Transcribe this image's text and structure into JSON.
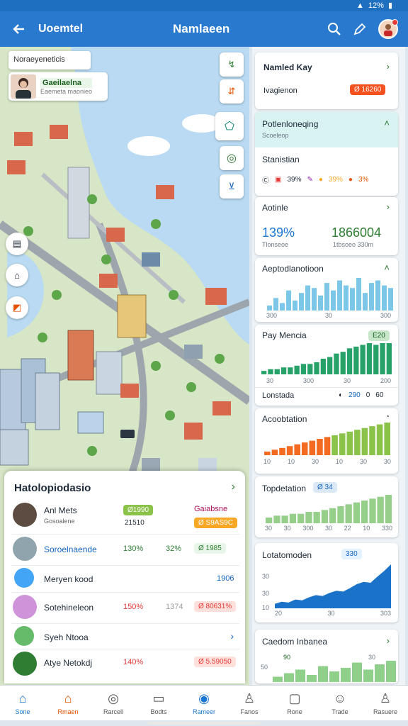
{
  "status": {
    "right": "12%"
  },
  "appbar": {
    "left_title": "Uoemtel",
    "center_title": "Namlaeen"
  },
  "map": {
    "search_placeholder": "Noraeyeneticis",
    "profile_name": "Gaeilaelna",
    "profile_sub": "Eaemeta maonieo"
  },
  "cards": {
    "named_key": {
      "title": "Namled Kay",
      "label": "Ivagienon",
      "badge": "Ø 16260"
    },
    "potential": {
      "title": "Potlenloneqing",
      "sub": "Scoeleop"
    },
    "stats": {
      "title": "Stanistian",
      "v1": "39%",
      "v2": "39%",
      "v3": "3%"
    },
    "actie": {
      "title": "Aotinle",
      "left_value": "139%",
      "left_sub": "Tlonseoe",
      "right_value": "1866004",
      "right_sub": "1tbsoeo 330m",
      "chart_data": {
        "type": "bar",
        "values": []
      }
    },
    "appreciation": {
      "title": "Aeptodlanotioon",
      "ticks": [
        "300",
        "30",
        "300"
      ],
      "chart_data": {
        "type": "bar",
        "values": [
          2,
          5,
          3,
          8,
          4,
          7,
          10,
          9,
          6,
          11,
          8,
          12,
          10,
          9,
          13,
          7,
          11,
          12,
          10,
          9
        ]
      }
    },
    "pay": {
      "title": "Pay Mencia",
      "badge": "E20",
      "ticks": [
        "30",
        "300",
        "30",
        "200"
      ],
      "chart_data": {
        "type": "bar",
        "values": [
          2,
          3,
          3,
          4,
          4,
          5,
          6,
          6,
          7,
          9,
          10,
          12,
          13,
          15,
          16,
          17,
          18,
          17,
          18,
          18
        ]
      }
    },
    "london": {
      "title": "Lonstada",
      "v1": "290",
      "v2": "0",
      "v3": "60"
    },
    "acceleration": {
      "title": "Acoobtation",
      "ticks": [
        "10",
        "10",
        "30",
        "10",
        "30",
        "30"
      ],
      "chart_data": {
        "type": "bar",
        "values": [
          2,
          3,
          4,
          5,
          6,
          7,
          8,
          9,
          10,
          11,
          12,
          13,
          14,
          15,
          16,
          17,
          18
        ]
      }
    },
    "topdetation": {
      "title": "Topdetation",
      "badge": "Ø 34",
      "ticks": [
        "30",
        "30",
        "300",
        "30",
        "22",
        "10",
        "330"
      ],
      "chart_data": {
        "type": "bar",
        "values": [
          3,
          4,
          4,
          5,
          5,
          6,
          6,
          7,
          8,
          9,
          10,
          11,
          12,
          13,
          14,
          15
        ]
      }
    },
    "lotato": {
      "title": "Lotatomoden",
      "badge": "330",
      "yticks": [
        "30",
        "30",
        "10"
      ],
      "xticks": [
        "20",
        "30",
        "303"
      ],
      "chart_data": {
        "type": "area",
        "values": [
          10,
          15,
          13,
          20,
          18,
          25,
          30,
          28,
          35,
          40,
          38,
          46,
          55,
          60,
          58,
          72,
          85,
          100
        ]
      }
    },
    "caedom": {
      "title": "Caedom Inbanea",
      "y_tick": "50",
      "x_labels": [
        "90",
        "30"
      ],
      "chart_data": {
        "type": "bar",
        "values": [
          3,
          5,
          7,
          4,
          9,
          6,
          8,
          11,
          7,
          10,
          12
        ]
      }
    }
  },
  "bottomsheet": {
    "title": "Hatolopiodasio",
    "rows": [
      {
        "name": "Anl Mets",
        "sub": "Gosoalene",
        "pill": "Ø1990",
        "value": "21510",
        "right_pill": "Ø S9AS9C",
        "mid": "Gaiabsne"
      },
      {
        "name": "Soroelnaende",
        "value1": "130%",
        "value2": "32%",
        "pill": "Ø 1985"
      },
      {
        "name": "Meryen kood",
        "value": "1906"
      },
      {
        "name": "Sotehineleon",
        "value1": "150%",
        "value2": "1374",
        "pill": "Ø 80631%"
      },
      {
        "name": "Syeh Ntooa"
      },
      {
        "name": "Atye Netokdj",
        "value1": "140%",
        "pill": "Ø 5.59050"
      }
    ]
  },
  "nav": [
    "Sone",
    "Rmaen",
    "Rarcell",
    "Bodts",
    "Rameer",
    "Fanos",
    "Rone",
    "Trade",
    "Rasuere"
  ]
}
